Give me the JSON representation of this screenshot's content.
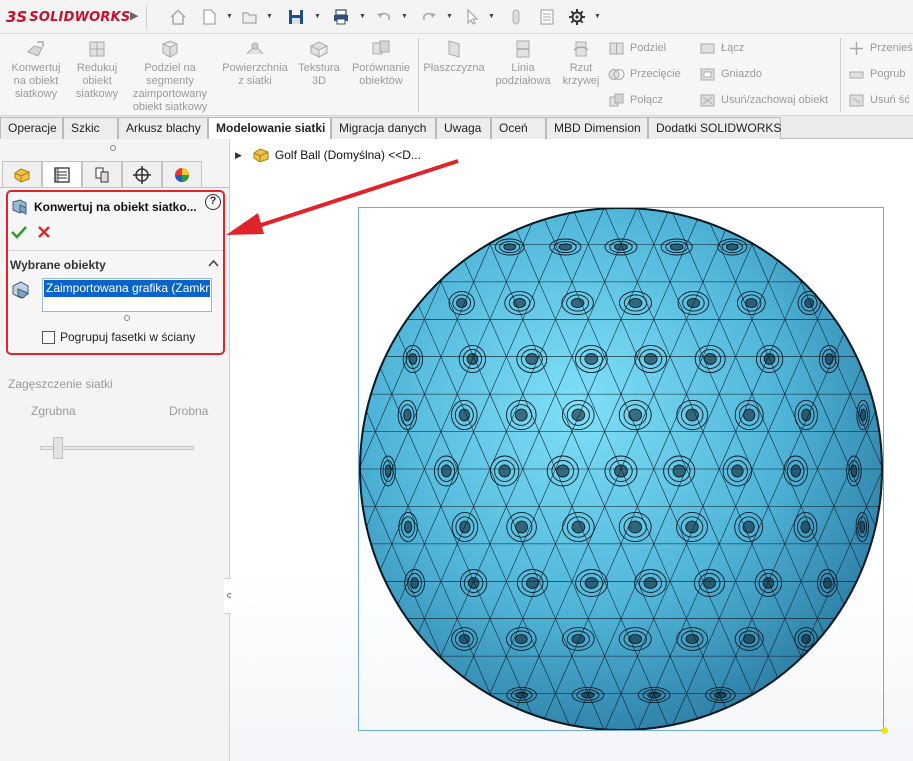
{
  "app": {
    "logo_ds": "3S",
    "logo_text": "SOLIDWORKS"
  },
  "toolbar": {
    "icons": [
      "home-icon",
      "new-document-icon",
      "open-icon",
      "save-icon",
      "print-icon",
      "undo-icon",
      "redo-icon",
      "select-icon",
      "rebuild-icon",
      "file-properties-icon",
      "options-gear-icon"
    ]
  },
  "ribbon": {
    "large_buttons": [
      {
        "id": "convert-to-mesh",
        "lines": [
          "Konwertuj",
          "na obiekt",
          "siatkowy"
        ]
      },
      {
        "id": "mesh-reduction",
        "lines": [
          "Redukuj",
          "obiekt",
          "siatkowy"
        ]
      },
      {
        "id": "segment-imported-mesh",
        "lines": [
          "Podziel na",
          "segmenty",
          "zaimportowany",
          "obiekt siatkowy"
        ]
      },
      {
        "id": "surface-from-mesh",
        "lines": [
          "Powierzchnia",
          "z siatki"
        ]
      },
      {
        "id": "texture-3d",
        "lines": [
          "Tekstura",
          "3D"
        ]
      },
      {
        "id": "compare-bodies",
        "lines": [
          "Porównanie",
          "obiektów"
        ]
      },
      {
        "id": "plane",
        "lines": [
          "Płaszczyzna"
        ]
      },
      {
        "id": "parting-line",
        "lines": [
          "Linia",
          "podziałowa"
        ]
      },
      {
        "id": "curve-projection",
        "lines": [
          "Rzut",
          "krzywej"
        ]
      }
    ],
    "small_buttons": [
      {
        "id": "split",
        "label": "Podziel"
      },
      {
        "id": "intersect",
        "label": "Przecięcie"
      },
      {
        "id": "combine",
        "label": "Połącz"
      },
      {
        "id": "join",
        "label": "Łącz"
      },
      {
        "id": "cavity",
        "label": "Gniazdo"
      },
      {
        "id": "delete-keep-body",
        "label": "Usuń/zachowaj obiekt"
      },
      {
        "id": "move-copy",
        "label": "Przenieś"
      },
      {
        "id": "thicken",
        "label": "Pogrub"
      },
      {
        "id": "delete-face",
        "label": "Usuń ść"
      }
    ]
  },
  "tabs": [
    {
      "label": "Operacje",
      "active": false
    },
    {
      "label": "Szkic",
      "active": false
    },
    {
      "label": "Arkusz blachy",
      "active": false
    },
    {
      "label": "Modelowanie siatki",
      "active": true
    },
    {
      "label": "Migracja danych",
      "active": false
    },
    {
      "label": "Uwaga",
      "active": false
    },
    {
      "label": "Oceń",
      "active": false
    },
    {
      "label": "MBD Dimension",
      "active": false
    },
    {
      "label": "Dodatki SOLIDWORKS",
      "active": false
    }
  ],
  "panel_tabs": [
    "feature-manager-icon",
    "property-manager-icon",
    "configuration-manager-icon",
    "dimxpert-icon",
    "display-manager-icon"
  ],
  "property_manager": {
    "title": "Konwertuj na obiekt siatko...",
    "help": "?",
    "section_title": "Wybrane obiekty",
    "selected_item": "Zaimportowana grafika (Zamkni",
    "checkbox_label": "Pogrupuj fasetki w ściany",
    "checkbox_checked": false
  },
  "density": {
    "title": "Zagęszczenie siatki",
    "min_label": "Zgrubna",
    "max_label": "Drobna",
    "value_fraction": 0.12
  },
  "graphics": {
    "tree_node": "Golf Ball (Domyślna) <<D...",
    "colors": {
      "sphere_fill": "#5ec8e8",
      "mesh_lines": "#0b1a24",
      "bbox": "#6fa7d8",
      "highlight": "#e0242a"
    }
  }
}
